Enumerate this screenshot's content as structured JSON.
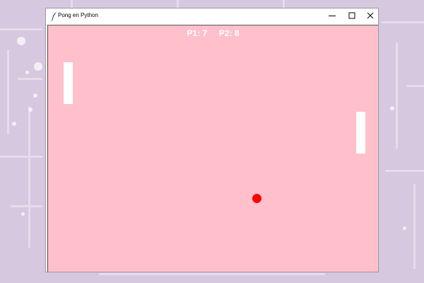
{
  "window": {
    "title": "Pong en Python",
    "icon": "feather-icon"
  },
  "controls": {
    "minimize_icon": "minimize-icon",
    "maximize_icon": "maximize-icon",
    "close_icon": "close-icon"
  },
  "game": {
    "background_color": "#ffc0cb",
    "paddle_color": "#ffffff",
    "ball_color": "#ff0000",
    "score": {
      "p1_label": "P1:",
      "p1_value": "7",
      "p2_label": "P2:",
      "p2_value": "8"
    }
  }
}
